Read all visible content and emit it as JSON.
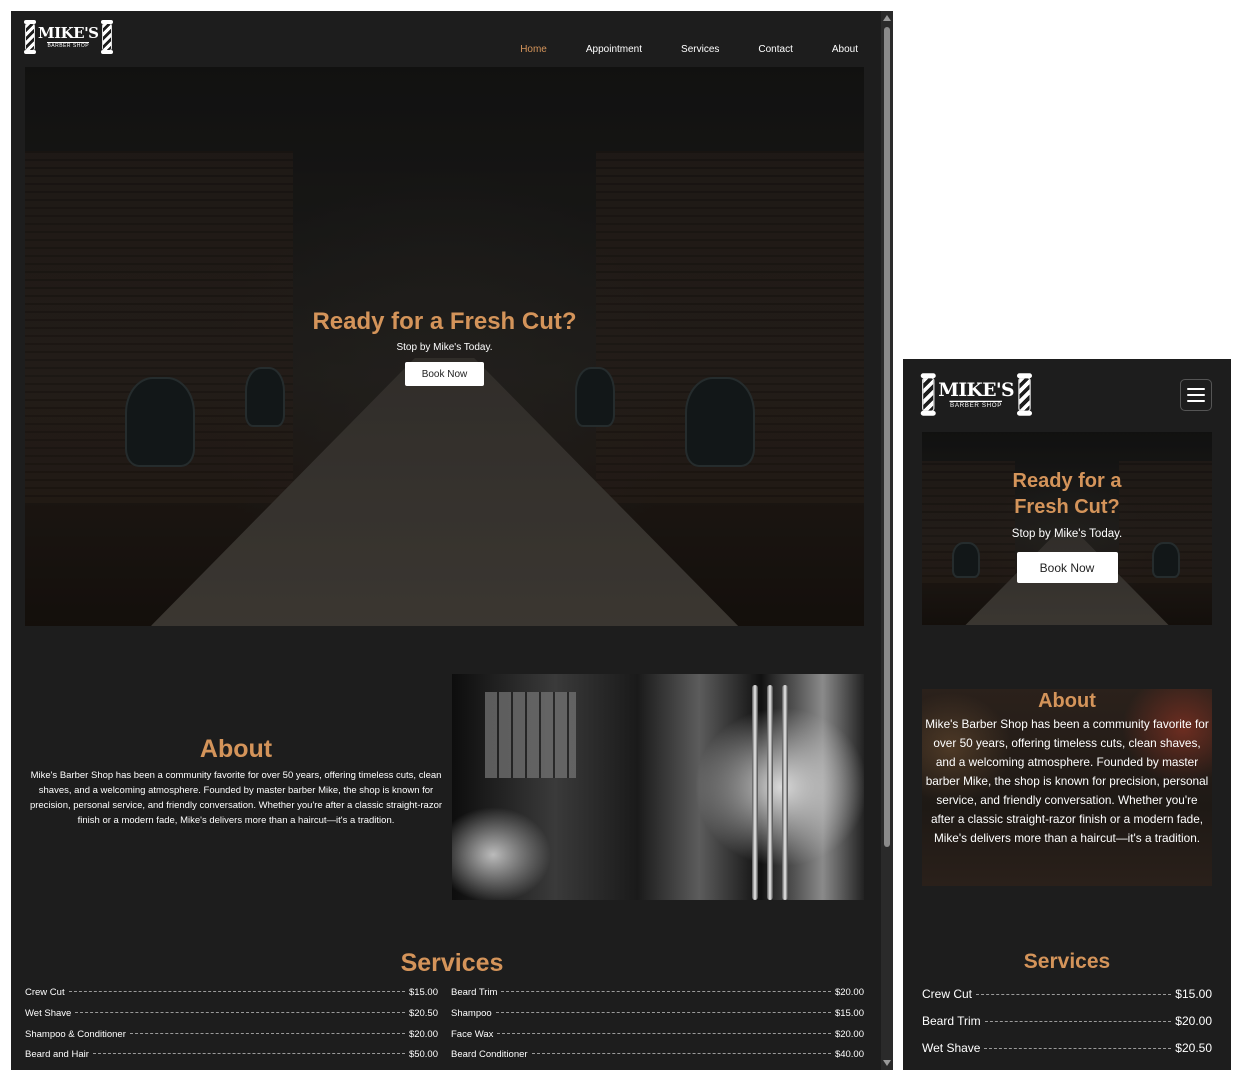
{
  "logo": {
    "name": "MIKE'S",
    "tagline": "BARBER SHOP"
  },
  "nav": {
    "items": [
      {
        "label": "Home",
        "active": true
      },
      {
        "label": "Appointment",
        "active": false
      },
      {
        "label": "Services",
        "active": false
      },
      {
        "label": "Contact",
        "active": false
      },
      {
        "label": "About",
        "active": false
      }
    ]
  },
  "hero": {
    "title": "Ready for a Fresh Cut?",
    "subtitle": "Stop by Mike's Today.",
    "button": "Book Now"
  },
  "about": {
    "title": "About",
    "body": "Mike's Barber Shop has been a community favorite for over 50 years, offering timeless cuts, clean shaves, and a welcoming atmosphere. Founded by master barber Mike, the shop is known for precision, personal service, and friendly conversation. Whether you're after a classic straight-razor finish or a modern fade, Mike's delivers more than a haircut—it's a tradition."
  },
  "services": {
    "title": "Services",
    "left": [
      {
        "name": "Crew Cut",
        "price": "$15.00"
      },
      {
        "name": "Wet Shave",
        "price": "$20.50"
      },
      {
        "name": "Shampoo & Conditioner",
        "price": "$20.00"
      },
      {
        "name": "Beard and Hair",
        "price": "$50.00"
      }
    ],
    "right": [
      {
        "name": "Beard Trim",
        "price": "$20.00"
      },
      {
        "name": "Shampoo",
        "price": "$15.00"
      },
      {
        "name": "Face Wax",
        "price": "$20.00"
      },
      {
        "name": "Beard Conditioner",
        "price": "$40.00"
      }
    ],
    "mobile": [
      {
        "name": "Crew Cut",
        "price": "$15.00"
      },
      {
        "name": "Beard Trim",
        "price": "$20.00"
      },
      {
        "name": "Wet Shave",
        "price": "$20.50"
      }
    ]
  },
  "colors": {
    "accent": "#d4945a",
    "background": "#1d1d1d",
    "text": "#ffffff"
  },
  "icons": {
    "menu": "hamburger-icon",
    "logo": "barber-pole-icon"
  }
}
